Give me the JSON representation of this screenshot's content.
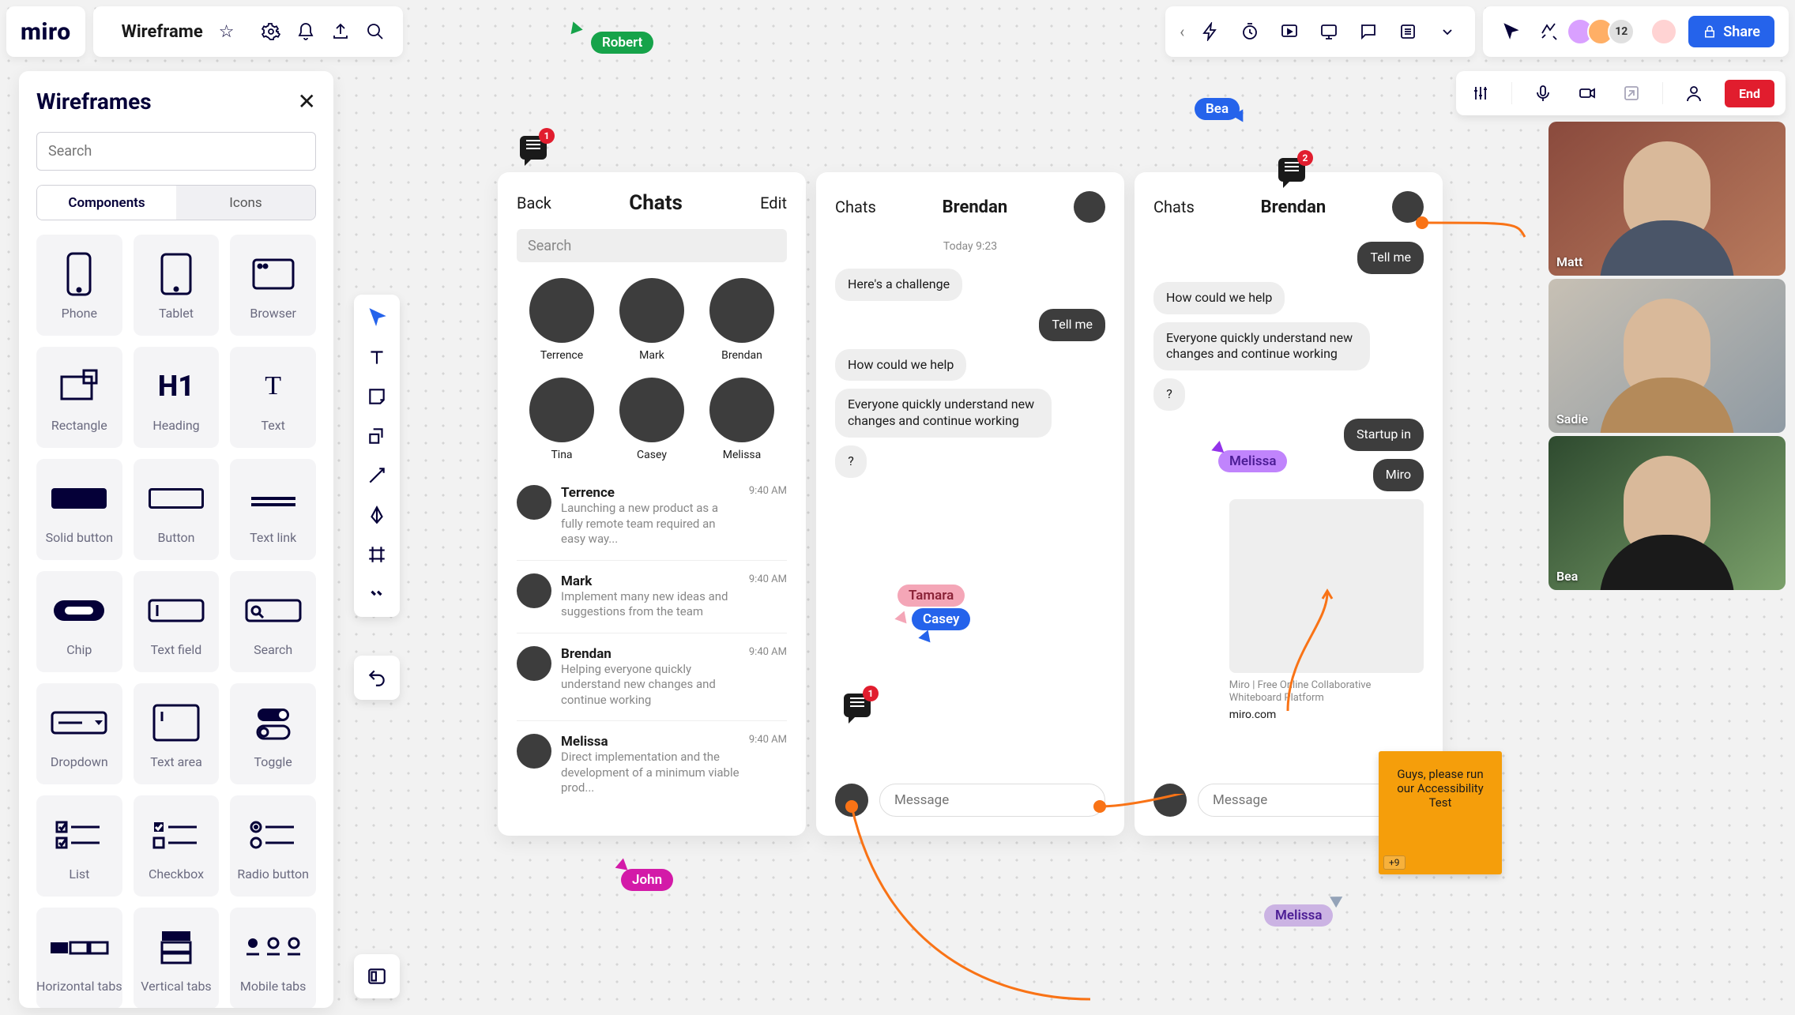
{
  "board": {
    "logo": "miro",
    "name": "Wireframe"
  },
  "topbar_icons": [
    "settings",
    "bell",
    "upload",
    "search"
  ],
  "right_toolbar_icons": [
    "bolt",
    "timer",
    "present",
    "screen",
    "comment",
    "list",
    "more"
  ],
  "presence_count": "12",
  "share": "Share",
  "callbar": {
    "end": "End"
  },
  "panel": {
    "title": "Wireframes",
    "search_ph": "Search",
    "tabs": [
      "Components",
      "Icons"
    ],
    "items": [
      "Phone",
      "Tablet",
      "Browser",
      "Rectangle",
      "Heading",
      "Text",
      "Solid button",
      "Button",
      "Text link",
      "Chip",
      "Text field",
      "Search",
      "Dropdown",
      "Text area",
      "Toggle",
      "List",
      "Checkbox",
      "Radio button",
      "Horizontal tabs",
      "Vertical tabs",
      "Mobile tabs"
    ]
  },
  "toolstrip": [
    "select",
    "text",
    "sticky",
    "shape",
    "line",
    "pen",
    "frame",
    "more"
  ],
  "cursors": {
    "robert": "Robert",
    "bea": "Bea",
    "john": "John",
    "tamara": "Tamara",
    "casey": "Casey",
    "melissa": "Melissa",
    "melissa2": "Melissa"
  },
  "comments": {
    "c1": "1",
    "c2": "1",
    "c3": "2"
  },
  "sticky": {
    "text": "Guys, please run our Accessibility Test",
    "plus": "+9"
  },
  "wf1": {
    "back": "Back",
    "title": "Chats",
    "edit": "Edit",
    "search": "Search",
    "people_row1": [
      "Terrence",
      "Mark",
      "Brendan"
    ],
    "people_row2": [
      "Tina",
      "Casey",
      "Melissa"
    ],
    "chats": [
      {
        "name": "Terrence",
        "time": "9:40 AM",
        "prev": "Launching a new product as a fully remote team required an easy way..."
      },
      {
        "name": "Mark",
        "time": "9:40 AM",
        "prev": "Implement many new ideas and suggestions from the team"
      },
      {
        "name": "Brendan",
        "time": "9:40 AM",
        "prev": "Helping everyone quickly understand new changes and continue working"
      },
      {
        "name": "Melissa",
        "time": "9:40 AM",
        "prev": "Direct implementation and the development of a minimum viable prod..."
      }
    ]
  },
  "wf2": {
    "left": "Chats",
    "title": "Brendan",
    "ts": "Today 9:23",
    "msgs": [
      {
        "t": "Here's a challenge",
        "side": "in"
      },
      {
        "t": "Tell me",
        "side": "out"
      },
      {
        "t": "How could we help",
        "side": "in"
      },
      {
        "t": "Everyone quickly understand new changes and continue working",
        "side": "in"
      },
      {
        "t": "?",
        "side": "in"
      }
    ],
    "msg_ph": "Message"
  },
  "wf3": {
    "left": "Chats",
    "title": "Brendan",
    "msgs": [
      {
        "t": "Tell me",
        "side": "out"
      },
      {
        "t": "How could we help",
        "side": "in"
      },
      {
        "t": "Everyone quickly understand new changes and continue working",
        "side": "in"
      },
      {
        "t": "?",
        "side": "in"
      },
      {
        "t": "Startup in",
        "side": "out"
      },
      {
        "t": "Miro",
        "side": "out"
      }
    ],
    "link": {
      "meta": "Miro | Free Online Collaborative Whiteboard Platform",
      "url": "miro.com"
    },
    "msg_ph": "Message"
  },
  "videos": [
    "Matt",
    "Sadie",
    "Bea"
  ]
}
